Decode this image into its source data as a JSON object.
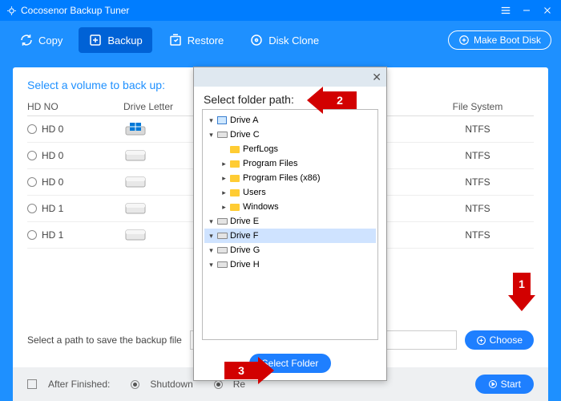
{
  "app": {
    "title": "Cocosenor Backup Tuner"
  },
  "toolbar": {
    "copy": "Copy",
    "backup": "Backup",
    "restore": "Restore",
    "diskclone": "Disk Clone",
    "boot": "Make Boot Disk"
  },
  "main": {
    "heading": "Select a volume to back up:",
    "columns": {
      "hd": "HD NO",
      "drive": "Drive Letter",
      "fs": "File System"
    },
    "rows": [
      {
        "hd": "HD 0",
        "fs": "NTFS",
        "os": true
      },
      {
        "hd": "HD 0",
        "fs": "NTFS",
        "os": false
      },
      {
        "hd": "HD 0",
        "fs": "NTFS",
        "os": false
      },
      {
        "hd": "HD 1",
        "fs": "NTFS",
        "os": false
      },
      {
        "hd": "HD 1",
        "fs": "NTFS",
        "os": false
      }
    ],
    "path_label": "Select a path to save the backup file",
    "choose": "Choose"
  },
  "footer": {
    "after": "After Finished:",
    "shutdown": "Shutdown",
    "restart": "Re",
    "start": "Start"
  },
  "modal": {
    "heading": "Select folder path:",
    "select": "Select Folder",
    "tree": [
      {
        "depth": 0,
        "label": "Drive A",
        "icon": "pc",
        "arrow": "▾"
      },
      {
        "depth": 0,
        "label": "Drive C",
        "icon": "drive",
        "arrow": "▾"
      },
      {
        "depth": 1,
        "label": "PerfLogs",
        "icon": "folder",
        "arrow": ""
      },
      {
        "depth": 1,
        "label": "Program Files",
        "icon": "folder",
        "arrow": "▸"
      },
      {
        "depth": 1,
        "label": "Program Files (x86)",
        "icon": "folder",
        "arrow": "▸"
      },
      {
        "depth": 1,
        "label": "Users",
        "icon": "folder",
        "arrow": "▸"
      },
      {
        "depth": 1,
        "label": "Windows",
        "icon": "folder",
        "arrow": "▸"
      },
      {
        "depth": 0,
        "label": "Drive E",
        "icon": "drive",
        "arrow": "▾"
      },
      {
        "depth": 0,
        "label": "Drive F",
        "icon": "drive",
        "arrow": "▾",
        "selected": true
      },
      {
        "depth": 0,
        "label": "Drive G",
        "icon": "drive",
        "arrow": "▾"
      },
      {
        "depth": 0,
        "label": "Drive H",
        "icon": "drive",
        "arrow": "▾"
      }
    ]
  },
  "annotations": {
    "a1": "1",
    "a2": "2",
    "a3": "3"
  }
}
